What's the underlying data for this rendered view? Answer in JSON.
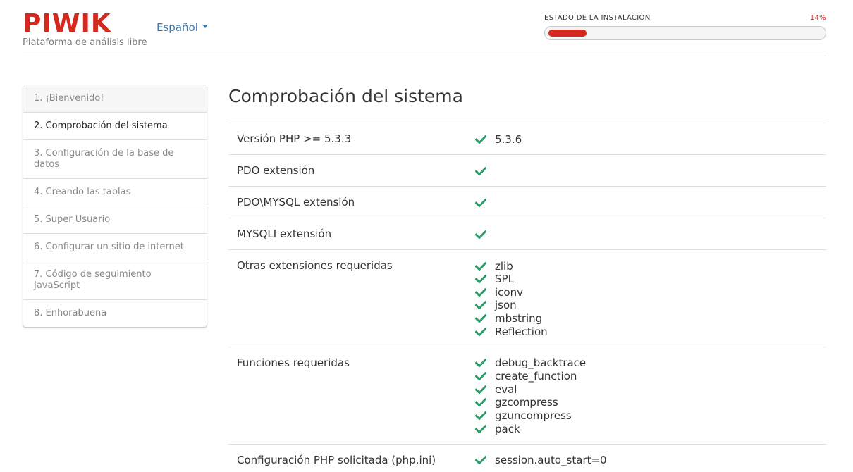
{
  "header": {
    "logo": "PIWIK",
    "tagline": "Plataforma de análisis libre",
    "language": "Español",
    "status_label": "ESTADO DE LA INSTALACIÓN",
    "status_percent": "14%",
    "progress_value": 0.14
  },
  "steps": [
    {
      "label": "1. ¡Bienvenido!"
    },
    {
      "label": "2. Comprobación del sistema"
    },
    {
      "label": "3. Configuración de la base de datos"
    },
    {
      "label": "4. Creando las tablas"
    },
    {
      "label": "5. Super Usuario"
    },
    {
      "label": "6. Configurar un sitio de internet"
    },
    {
      "label": "7. Código de seguimiento JavaScript"
    },
    {
      "label": "8. Enhorabuena"
    }
  ],
  "main": {
    "title": "Comprobación del sistema",
    "rows": [
      {
        "label": "Versión PHP >= 5.3.3",
        "values": [
          "5.3.6"
        ]
      },
      {
        "label": "PDO extensión",
        "values": [
          ""
        ]
      },
      {
        "label": "PDO\\MYSQL extensión",
        "values": [
          ""
        ]
      },
      {
        "label": "MYSQLI extensión",
        "values": [
          ""
        ]
      },
      {
        "label": "Otras extensiones requeridas",
        "values": [
          "zlib",
          "SPL",
          "iconv",
          "json",
          "mbstring",
          "Reflection"
        ]
      },
      {
        "label": "Funciones requeridas",
        "values": [
          "debug_backtrace",
          "create_function",
          "eval",
          "gzcompress",
          "gzuncompress",
          "pack"
        ]
      },
      {
        "label": "Configuración PHP solicitada (php.ini)",
        "values": [
          "session.auto_start=0"
        ]
      }
    ]
  },
  "icons": {
    "check": "check-icon",
    "check_color": "#2e9e6b"
  },
  "colors": {
    "brand": "#d4291f",
    "link": "#3a77ad"
  }
}
